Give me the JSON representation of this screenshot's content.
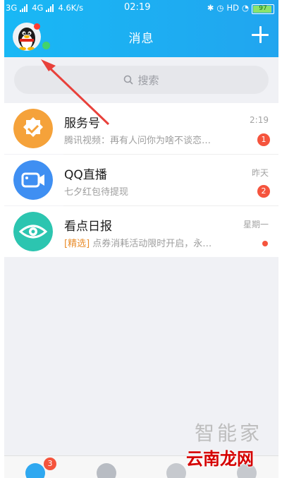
{
  "status_bar": {
    "network1": "3G",
    "network2": "4G",
    "speed": "4.6K/s",
    "time": "02:19",
    "hd": "HD",
    "battery": "97"
  },
  "header": {
    "title": "消息"
  },
  "search": {
    "placeholder": "搜索"
  },
  "conversations": [
    {
      "name": "服务号",
      "preview": "腾讯视频：再有人问你为啥不谈恋…",
      "time": "2:19",
      "badge": "1",
      "color": "#f5a23a"
    },
    {
      "name": "QQ直播",
      "preview": "七夕红包待提现",
      "time": "昨天",
      "badge": "2",
      "color": "#3f8ff2"
    },
    {
      "name": "看点日报",
      "tag": "[精选]",
      "preview": " 点券消耗活动限时开启，永…",
      "time": "星期一",
      "color": "#2cc5b0"
    }
  ],
  "tabbar": {
    "messages_badge": "3"
  },
  "watermark": {
    "text1": "智能家",
    "text2": "云南龙网"
  },
  "colors": {
    "header_start": "#19b8f5",
    "header_end": "#21a5ef",
    "badge": "#f5543d",
    "annotation_arrow": "#e8413b"
  }
}
